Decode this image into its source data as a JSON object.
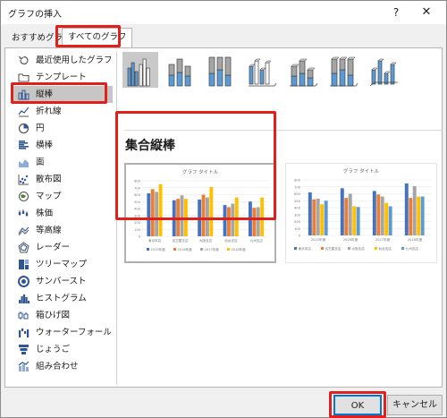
{
  "window": {
    "title": "グラフの挿入",
    "help_label": "?",
    "close_label": "✕"
  },
  "tabs": [
    {
      "label": "おすすめグラフ"
    },
    {
      "label": "すべてのグラフ"
    }
  ],
  "sidebar": {
    "items": [
      {
        "label": "最近使用したグラフ",
        "icon": "recent-icon"
      },
      {
        "label": "テンプレート",
        "icon": "template-folder-icon"
      },
      {
        "label": "縦棒",
        "icon": "column-chart-icon"
      },
      {
        "label": "折れ線",
        "icon": "line-chart-icon"
      },
      {
        "label": "円",
        "icon": "pie-chart-icon"
      },
      {
        "label": "横棒",
        "icon": "bar-chart-icon"
      },
      {
        "label": "面",
        "icon": "area-chart-icon"
      },
      {
        "label": "散布図",
        "icon": "scatter-chart-icon"
      },
      {
        "label": "マップ",
        "icon": "map-chart-icon"
      },
      {
        "label": "株価",
        "icon": "stock-chart-icon"
      },
      {
        "label": "等高線",
        "icon": "surface-chart-icon"
      },
      {
        "label": "レーダー",
        "icon": "radar-chart-icon"
      },
      {
        "label": "ツリーマップ",
        "icon": "treemap-chart-icon"
      },
      {
        "label": "サンバースト",
        "icon": "sunburst-chart-icon"
      },
      {
        "label": "ヒストグラム",
        "icon": "histogram-chart-icon"
      },
      {
        "label": "箱ひげ図",
        "icon": "box-whisker-chart-icon"
      },
      {
        "label": "ウォーターフォール",
        "icon": "waterfall-chart-icon"
      },
      {
        "label": "じょうご",
        "icon": "funnel-chart-icon"
      },
      {
        "label": "組み合わせ",
        "icon": "combo-chart-icon"
      }
    ],
    "selected_index": 2
  },
  "subtypes": {
    "selected_index": 0,
    "selected_name": "集合縦棒",
    "items": [
      {
        "icon": "clustered-column-icon"
      },
      {
        "icon": "stacked-column-icon"
      },
      {
        "icon": "100-stacked-column-icon"
      },
      {
        "icon": "3d-clustered-column-icon"
      },
      {
        "icon": "3d-stacked-column-icon"
      },
      {
        "icon": "3d-100-stacked-column-icon"
      },
      {
        "icon": "3d-column-icon"
      }
    ]
  },
  "chart_data": [
    {
      "type": "bar",
      "title": "グラフ タイトル",
      "categories": [
        "東京本店",
        "名古屋支店",
        "大阪支店",
        "仙台支店",
        "九州支店"
      ],
      "ylim": [
        0,
        800
      ],
      "yticks": [
        "0",
        "100",
        "200",
        "300",
        "400",
        "500",
        "600",
        "700",
        "800"
      ],
      "series": [
        {
          "name": "2015年度",
          "color": "#4472c4",
          "values": [
            620,
            520,
            530,
            450,
            500
          ]
        },
        {
          "name": "2016年度",
          "color": "#ed7d31",
          "values": [
            680,
            540,
            600,
            420,
            410
          ]
        },
        {
          "name": "2017年度",
          "color": "#a5a5a5",
          "values": [
            640,
            590,
            560,
            470,
            420
          ]
        },
        {
          "name": "2018年度",
          "color": "#ffc000",
          "values": [
            750,
            540,
            710,
            560,
            560
          ]
        }
      ]
    },
    {
      "type": "bar",
      "title": "グラフ タイトル",
      "categories": [
        "2015年度",
        "2016年度",
        "2017年度",
        "2018年度"
      ],
      "ylim": [
        0,
        800
      ],
      "yticks": [
        "0",
        "100",
        "200",
        "300",
        "400",
        "500",
        "600",
        "700",
        "800"
      ],
      "series": [
        {
          "name": "東京本店",
          "color": "#4472c4",
          "values": [
            620,
            680,
            640,
            750
          ]
        },
        {
          "name": "名古屋支店",
          "color": "#ed7d31",
          "values": [
            520,
            540,
            590,
            540
          ]
        },
        {
          "name": "大阪支店",
          "color": "#a5a5a5",
          "values": [
            530,
            600,
            560,
            710
          ]
        },
        {
          "name": "仙台支店",
          "color": "#ffc000",
          "values": [
            450,
            420,
            470,
            560
          ]
        },
        {
          "name": "九州支店",
          "color": "#5b9bd5",
          "values": [
            500,
            410,
            420,
            560
          ]
        }
      ]
    }
  ],
  "buttons": {
    "ok_label": "OK",
    "cancel_label": "キャンセル"
  }
}
